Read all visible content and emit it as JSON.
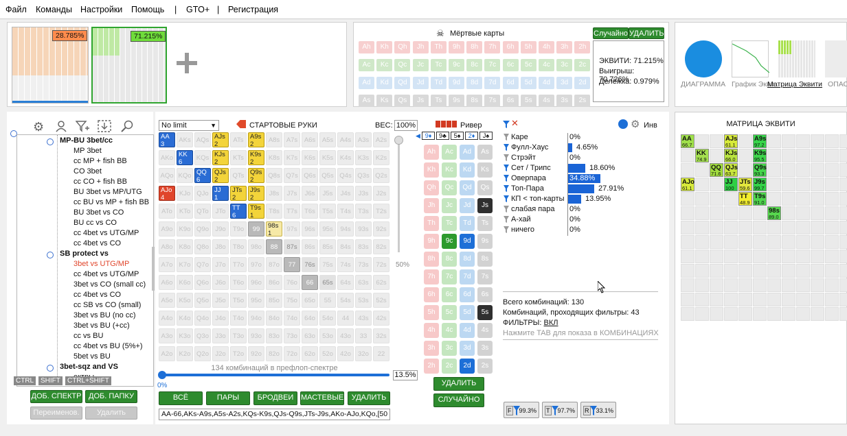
{
  "menu": [
    "Файл",
    "Команды",
    "Настройки",
    "Помощь",
    "|",
    "GTO+",
    "|",
    "Регистрация"
  ],
  "range_thumbs": [
    {
      "pct": "28.785%",
      "color": "#ff8c4d"
    },
    {
      "pct": "71.215%",
      "color": "#6fdc3a"
    }
  ],
  "dead_cards": {
    "title": "Мёртвые карты",
    "random_btn": "Случайно",
    "delete_btn": "УДАЛИТЬ",
    "rows": [
      [
        "Ah",
        "Kh",
        "Qh",
        "Jh",
        "Th",
        "9h",
        "8h",
        "7h",
        "6h",
        "5h",
        "4h",
        "3h",
        "2h"
      ],
      [
        "Ac",
        "Kc",
        "Qc",
        "Jc",
        "Tc",
        "9c",
        "8c",
        "7c",
        "6c",
        "5c",
        "4c",
        "3c",
        "2c"
      ],
      [
        "Ad",
        "Kd",
        "Qd",
        "Jd",
        "Td",
        "9d",
        "8d",
        "7d",
        "6d",
        "5d",
        "4d",
        "3d",
        "2d"
      ],
      [
        "As",
        "Ks",
        "Qs",
        "Js",
        "Ts",
        "9s",
        "8s",
        "7s",
        "6s",
        "5s",
        "4s",
        "3s",
        "2s"
      ]
    ]
  },
  "equity_box": {
    "equity": "ЭКВИТИ: 71.215%",
    "win": "Выигрыш: 70.726%",
    "tie": "Делёжка: 0.979%"
  },
  "views": {
    "diagram": "ДИАГРАММА",
    "graph": "График Экви",
    "matrix": "Матрица Эквити",
    "last": "ОПАСН"
  },
  "tree": {
    "items": [
      {
        "t": "MP-BU 3bet/cc",
        "bold": true
      },
      {
        "t": "MP 3bet"
      },
      {
        "t": "cc MP + fish BB"
      },
      {
        "t": "CO 3bet"
      },
      {
        "t": "cc CO + fish BB"
      },
      {
        "t": "BU 3bet vs MP/UTG"
      },
      {
        "t": "cc BU vs MP + fish BB"
      },
      {
        "t": "BU 3bet vs CO"
      },
      {
        "t": "BU cc vs CO"
      },
      {
        "t": "cc 4bet vs UTG/MP"
      },
      {
        "t": "cc 4bet vs CO"
      },
      {
        "t": "SB protect vs",
        "bold": true
      },
      {
        "t": "3bet vs UTG/MP",
        "red": true
      },
      {
        "t": "cc 4bet vs UTG/MP"
      },
      {
        "t": "3bet vs CO (small cc)"
      },
      {
        "t": "cc 4bet vs CO"
      },
      {
        "t": "cc SB vs CO (small)"
      },
      {
        "t": "3bet vs BU (no cc)"
      },
      {
        "t": "3bet vs BU (+cc)"
      },
      {
        "t": "cc vs BU"
      },
      {
        "t": "cc 4bet vs BU (5%+)"
      },
      {
        "t": "5bet vs BU"
      },
      {
        "t": "3bet-sqz and VS",
        "bold": true
      },
      {
        "t": "ектры"
      }
    ],
    "keys": [
      "CTRL",
      "SHIFT",
      "CTRL+SHIFT"
    ],
    "add_spectrum": "ДОБ. СПЕКТР",
    "add_folder": "ДОБ. ПАПКУ",
    "rename": "Переименов.",
    "delete": "Удалить"
  },
  "range": {
    "game": "No limit",
    "title": "СТАРТОВЫЕ РУКИ",
    "weight_label": "ВЕС:",
    "weight": "100%",
    "combos_caption": "134 комбинаций в префлоп-спектре",
    "slider_value": "13.5%",
    "slider_min": "0%",
    "side_pct": "50%",
    "buttons": [
      "ВСЁ",
      "ПАРЫ",
      "БРОДВЕИ",
      "МАСТЕВЫЕ",
      "УДАЛИТЬ"
    ],
    "range_text": "AA-66,AKs-A9s,A5s-A2s,KQs-K9s,QJs-Q9s,JTs-J9s,AKo-AJo,KQo,[50"
  },
  "river": {
    "title": "Ривер",
    "board": [
      "9♦",
      "9♣",
      "5♠",
      "2♦",
      "J♠"
    ],
    "delete": "УДАЛИТЬ",
    "random": "СЛУЧАЙНО"
  },
  "stats": {
    "inv": "Инв",
    "rows": [
      {
        "name": "Каре",
        "pct": "0%",
        "v": 0
      },
      {
        "name": "Фулл-Хаус",
        "pct": "4.65%",
        "v": 4.65
      },
      {
        "name": "Стрэйт",
        "pct": "0%",
        "v": 0
      },
      {
        "name": "Сет / Трипс",
        "pct": "18.60%",
        "v": 18.6
      },
      {
        "name": "Оверпара",
        "pct": "34.88%",
        "v": 34.88
      },
      {
        "name": "Топ-Пара",
        "pct": "27.91%",
        "v": 27.91
      },
      {
        "name": "КП < топ-карты",
        "pct": "13.95%",
        "v": 13.95
      },
      {
        "name": "слабая пара",
        "pct": "0%",
        "v": 0
      },
      {
        "name": "А-хай",
        "pct": "0%",
        "v": 0
      },
      {
        "name": "ничего",
        "pct": "0%",
        "v": 0
      }
    ],
    "total": "Всего комбинаций: 130",
    "passed": "Комбинаций, проходящих фильтры: 43",
    "filters_label": "ФИЛЬТРЫ: ",
    "filters_value": "ВКЛ",
    "hint": "Нажмите TAB для показа в КОМБИНАЦИЯХ",
    "filter_buttons": [
      {
        "l": "F",
        "v": "99.3%"
      },
      {
        "l": "T",
        "v": "97.7%"
      },
      {
        "l": "R",
        "v": "33.1%"
      }
    ]
  },
  "matrix": {
    "title": "МАТРИЦА ЭКВИТИ"
  }
}
